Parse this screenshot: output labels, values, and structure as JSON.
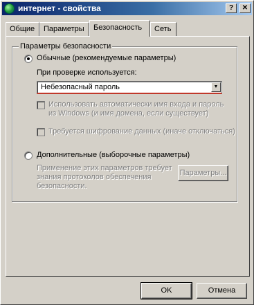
{
  "window": {
    "title": "интернет - свойства",
    "help_label": "?",
    "close_label": "✕"
  },
  "tabs": [
    {
      "label": "Общие"
    },
    {
      "label": "Параметры"
    },
    {
      "label": "Безопасность"
    },
    {
      "label": "Сеть"
    }
  ],
  "active_tab": "Безопасность",
  "security": {
    "group_title": "Параметры безопасности",
    "typical": {
      "label": "Обычные (рекомендуемые параметры)",
      "checked": true,
      "verify_label": "При проверке используется:",
      "verify_value": "Небезопасный пароль",
      "auto_login_label_line1": "Использовать автоматически имя входа и пароль",
      "auto_login_label_line2": "из Windows (и имя домена, если существует)",
      "encrypt_label": "Требуется шифрование данных (иначе отключаться)"
    },
    "advanced": {
      "label": "Дополнительные (выборочные параметры)",
      "checked": false,
      "description_line1": "Применение этих параметров требует",
      "description_line2": "знания протоколов обеспечения",
      "description_line3": "безопасности.",
      "settings_button": "Параметры..."
    }
  },
  "footer": {
    "ok_label": "OK",
    "cancel_label": "Отмена"
  }
}
